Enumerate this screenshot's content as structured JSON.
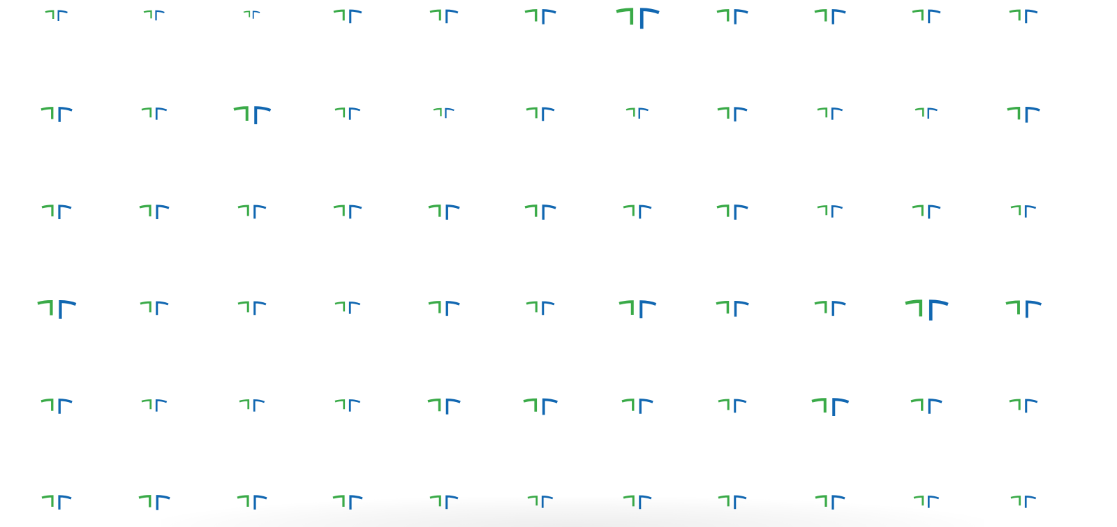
{
  "colors": {
    "background": "#ffffff",
    "left_mark": "#3aaa48",
    "right_mark": "#1167b1"
  },
  "grid": {
    "rows": 6,
    "columns": 11
  },
  "mark_icon": "stylized-T-logo-icon"
}
